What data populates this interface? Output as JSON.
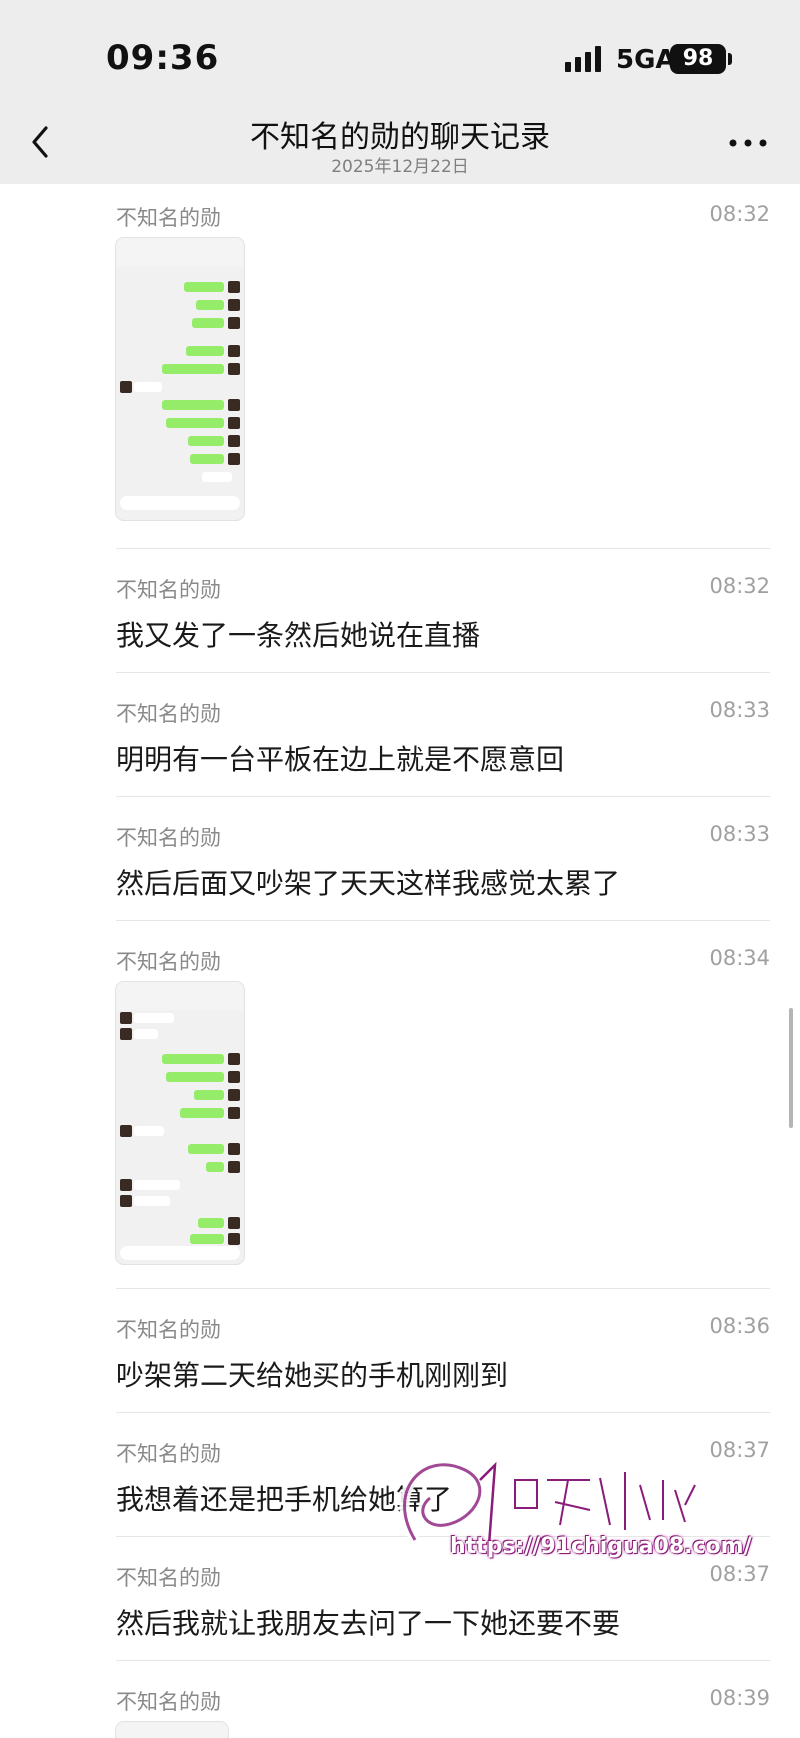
{
  "status": {
    "time": "09:36",
    "network": "5GA",
    "battery": "98"
  },
  "header": {
    "title": "不知名的勋的聊天记录",
    "date": "2025年12月22日"
  },
  "messages": [
    {
      "sender": "不知名的勋",
      "time": "08:32",
      "type": "image"
    },
    {
      "sender": "不知名的勋",
      "time": "08:32",
      "text": "我又发了一条然后她说在直播"
    },
    {
      "sender": "不知名的勋",
      "time": "08:33",
      "text": "明明有一台平板在边上就是不愿意回"
    },
    {
      "sender": "不知名的勋",
      "time": "08:33",
      "text": "然后后面又吵架了天天这样我感觉太累了"
    },
    {
      "sender": "不知名的勋",
      "time": "08:34",
      "type": "image"
    },
    {
      "sender": "不知名的勋",
      "time": "08:36",
      "text": "吵架第二天给她买的手机刚刚到"
    },
    {
      "sender": "不知名的勋",
      "time": "08:37",
      "text": "我想着还是把手机给她算了"
    },
    {
      "sender": "不知名的勋",
      "time": "08:37",
      "text": "然后我就让我朋友去问了一下她还要不要"
    },
    {
      "sender": "不知名的勋",
      "time": "08:39",
      "type": "image"
    }
  ],
  "watermark": {
    "logo": "91吃瓜中心",
    "url": "https://91chigua08.com/"
  },
  "colors": {
    "header_bg": "#ededed",
    "bubble_green": "#95ec69",
    "watermark": "#a0208a"
  },
  "icons": [
    "back-chevron-icon",
    "more-dots-icon",
    "signal-icon",
    "battery-icon"
  ]
}
